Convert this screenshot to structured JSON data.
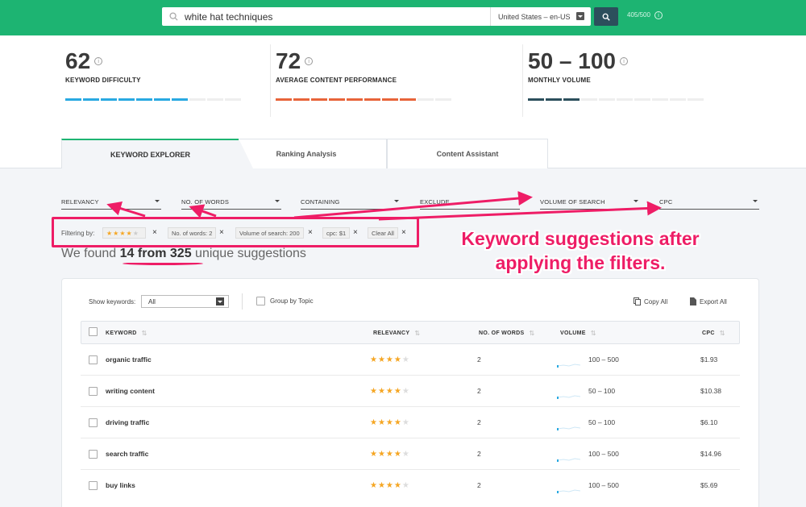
{
  "search": {
    "query": "white hat techniques",
    "locale": "United States – en-US",
    "credits": "405/500"
  },
  "metrics": [
    {
      "value": "62",
      "label": "KEYWORD DIFFICULTY",
      "color": "#29a9e1",
      "filled": 7,
      "total": 10
    },
    {
      "value": "72",
      "label": "AVERAGE CONTENT PERFORMANCE",
      "color": "#e8643a",
      "filled": 8,
      "total": 10
    },
    {
      "value": "50 – 100",
      "label": "MONTHLY VOLUME",
      "color": "#2c4f5c",
      "filled": 3,
      "total": 10
    }
  ],
  "tabs": [
    "KEYWORD EXPLORER",
    "Ranking Analysis",
    "Content Assistant"
  ],
  "filters": [
    "RELEVANCY",
    "NO. OF WORDS",
    "CONTAINING",
    "EXCLUDE",
    "VOLUME OF SEARCH",
    "CPC"
  ],
  "filtering": {
    "label": "Filtering by:",
    "stars": 4,
    "chips": [
      "No. of words: 2",
      "Volume of search: 200",
      "cpc: $1",
      "Clear All"
    ]
  },
  "found": {
    "prefix": "We found",
    "count": "14 from 325",
    "suffix": "unique suggestions"
  },
  "annotation": "Keyword suggestions after applying the filters.",
  "toolbar": {
    "show_label": "Show keywords:",
    "show_value": "All",
    "group_label": "Group by Topic",
    "copy_label": "Copy All",
    "export_label": "Export All"
  },
  "table": {
    "headers": [
      "KEYWORD",
      "RELEVANCY",
      "NO. OF WORDS",
      "VOLUME",
      "CPC"
    ],
    "rows": [
      {
        "keyword": "organic traffic",
        "stars": 4,
        "words": "2",
        "volume": "100 – 500",
        "cpc": "$1.93"
      },
      {
        "keyword": "writing content",
        "stars": 4,
        "words": "2",
        "volume": "50 – 100",
        "cpc": "$10.38"
      },
      {
        "keyword": "driving traffic",
        "stars": 4,
        "words": "2",
        "volume": "50 – 100",
        "cpc": "$6.10"
      },
      {
        "keyword": "search traffic",
        "stars": 4,
        "words": "2",
        "volume": "100 – 500",
        "cpc": "$14.96"
      },
      {
        "keyword": "buy links",
        "stars": 4,
        "words": "2",
        "volume": "100 – 500",
        "cpc": "$5.69"
      }
    ]
  }
}
